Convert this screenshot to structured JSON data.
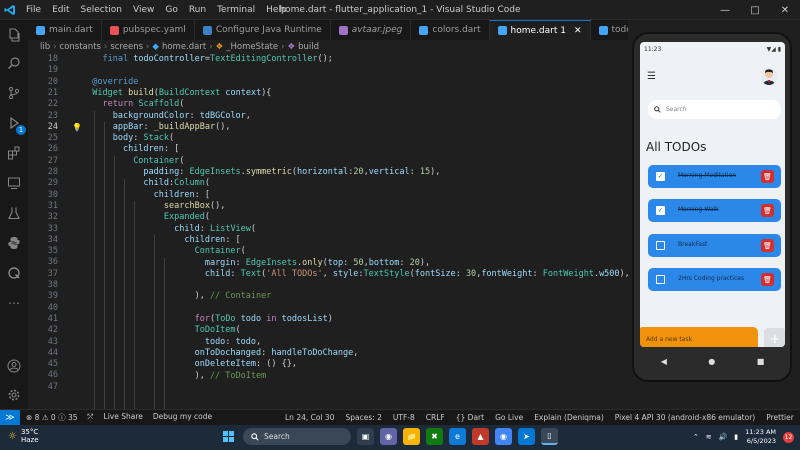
{
  "titlebar": {
    "menu": [
      "File",
      "Edit",
      "Selection",
      "View",
      "Go",
      "Run",
      "Terminal",
      "Help"
    ],
    "title": "home.dart - flutter_application_1 - Visual Studio Code"
  },
  "tabs": [
    {
      "label": "main.dart",
      "color": "#42a5f5"
    },
    {
      "label": "pubspec.yaml",
      "color": "#e55353"
    },
    {
      "label": "Configure Java Runtime",
      "color": "#3b82c4"
    },
    {
      "label": "avtaar.jpeg",
      "color": "#a074c4"
    },
    {
      "label": "colors.dart",
      "color": "#42a5f5"
    },
    {
      "label": "home.dart 1",
      "color": "#42a5f5",
      "active": true
    },
    {
      "label": "todo_item.dart",
      "color": "#42a5f5"
    }
  ],
  "breadcrumb": [
    "lib",
    "constants",
    "screens",
    "home.dart",
    "_HomeState",
    "build"
  ],
  "editor": {
    "current_line": 24,
    "lines": [
      18,
      19,
      20,
      21,
      22,
      23,
      24,
      25,
      26,
      27,
      28,
      29,
      30,
      31,
      32,
      33,
      34,
      35,
      36,
      37,
      38,
      39,
      40,
      41,
      42,
      43,
      44,
      45,
      46,
      47
    ]
  },
  "activity_badge": "1",
  "phone": {
    "time": "11:23",
    "status_right": "▼◢ ▮",
    "search_placeholder": "Search",
    "heading": "All TODOs",
    "todos": [
      {
        "text": "Morning Meditation",
        "done": true
      },
      {
        "text": "Morning Walk",
        "done": true
      },
      {
        "text": "BreakFast",
        "done": false
      },
      {
        "text": "2Hrs Coding practices",
        "done": false
      }
    ],
    "add_placeholder": "Add a new task",
    "add_button": "+"
  },
  "statusbar": {
    "remote": "≫",
    "problems": "⊗ 8 ⚠ 0 ⓘ 35",
    "ports": "⤱",
    "live_share": "Live Share",
    "debug": "Debug my code",
    "position": "Ln 24, Col 30",
    "spaces": "Spaces: 2",
    "encoding": "UTF-8",
    "eol": "CRLF",
    "language": "{} Dart",
    "golive": "Go Live",
    "explain": "Explain (Deniqma)",
    "device": "Pixel 4 API 30 (android-x86 emulator)",
    "prettier": "Prettier"
  },
  "taskbar": {
    "temp": "35°C",
    "weather": "Haze",
    "search": "Search",
    "time": "11:23 AM",
    "date": "6/5/2023",
    "notifications": "12"
  }
}
